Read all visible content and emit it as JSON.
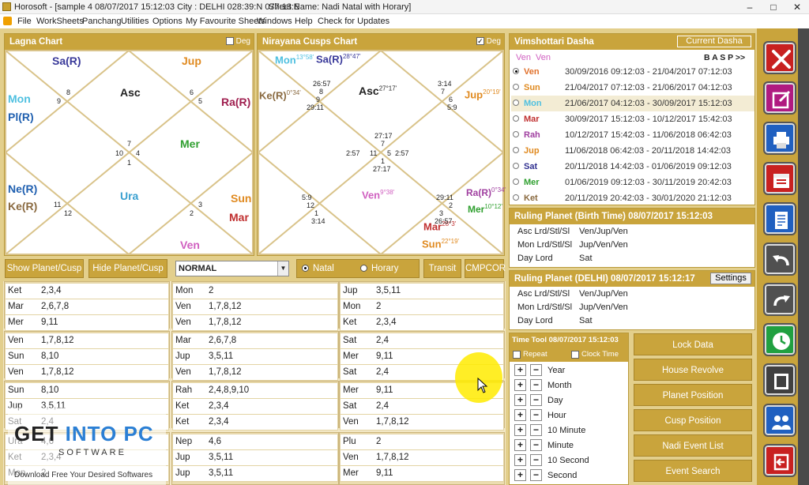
{
  "titlebar": {
    "app": "Horosoft - [sample 4 08/07/2017 15:12:03  City : DELHI 028:39:N 077:13:E",
    "sheet": "Sheet Name: Nadi Natal with Horary]",
    "min": "–",
    "max": "□",
    "close": "✕"
  },
  "menu": [
    "File",
    "WorkSheets",
    "Panchang",
    "Utilities",
    "Options",
    "My Favourite Sheets",
    "Windows",
    "Help",
    "Check for Updates"
  ],
  "lagna": {
    "title": "Lagna Chart",
    "deg": "Deg",
    "planets": {
      "sa": "Sa(R)",
      "jup": "Jup",
      "asc": "Asc",
      "mon": "Mon",
      "pl": "Pl(R)",
      "ra": "Ra(R)",
      "mer": "Mer",
      "ne": "Ne(R)",
      "ke": "Ke(R)",
      "ura": "Ura",
      "sun": "Sun",
      "mar": "Mar",
      "ven": "Ven"
    },
    "nums": {
      "n8": "8",
      "n9": "9",
      "n6": "6",
      "n5": "5",
      "n7": "7",
      "n10": "10",
      "n4": "4",
      "n1": "1",
      "n11": "11",
      "n12": "12",
      "n2": "2",
      "n3": "3"
    }
  },
  "nirayana": {
    "title": "Nirayana Cusps Chart",
    "deg": "Deg",
    "planets": {
      "mon": "Mon",
      "mon_d": "13°58'",
      "sa": "Sa(R)",
      "sa_d": "28°47'",
      "ke": "Ke(R)",
      "ke_d": "0°34'",
      "asc": "Asc",
      "asc_d": "27°17'",
      "jup": "Jup",
      "jup_d": "20°19'",
      "ven": "Ven",
      "ven_d": "9°38'",
      "ra": "Ra(R)",
      "ra_d": "0°34'",
      "mer": "Mer",
      "mer_d": "10°12'",
      "mar": "Mar",
      "mar_d": "28°3'",
      "sun": "Sun",
      "sun_d": "22°19'"
    },
    "nums": {
      "c1": "26:57",
      "c2": "8",
      "c3": "9",
      "c4": "29:11",
      "c5": "3:14",
      "c6": "7",
      "c7": "6",
      "c8": "5:9",
      "c9": "27:17",
      "c10": "7",
      "c11": "2:57",
      "c12": "11",
      "c13": "5",
      "c14": "2:57",
      "c15": "1",
      "c16": "27:17",
      "c17": "5:9",
      "c18": "12",
      "c19": "1",
      "c20": "3:14",
      "c21": "29:11",
      "c22": "2",
      "c23": "3",
      "c24": "26:57"
    }
  },
  "controls": {
    "show": "Show Planet/Cusp",
    "hide": "Hide Planet/Cusp",
    "select": "NORMAL",
    "natal": "Natal",
    "horary": "Horary",
    "transit": "Transit",
    "cmpcor": "CMPCOR"
  },
  "table": {
    "col1": [
      [
        "Ket",
        "2,3,4"
      ],
      [
        "Mar",
        "2,6,7,8"
      ],
      [
        "Mer",
        "9,11"
      ],
      [
        "Ven",
        "1,7,8,12"
      ],
      [
        "Sun",
        "8,10"
      ],
      [
        "Ven",
        "1,7,8,12"
      ],
      [
        "Sun",
        "8,10"
      ],
      [
        "Jup",
        "3,5,11"
      ],
      [
        "Sat",
        "2,4"
      ],
      [
        "Ura",
        "4,6"
      ],
      [
        "Ket",
        "2,3,4"
      ],
      [
        "Mon",
        "2"
      ]
    ],
    "col2": [
      [
        "Mon",
        "2"
      ],
      [
        "Ven",
        "1,7,8,12"
      ],
      [
        "Ven",
        "1,7,8,12"
      ],
      [
        "Mar",
        "2,6,7,8"
      ],
      [
        "Jup",
        "3,5,11"
      ],
      [
        "Ven",
        "1,7,8,12"
      ],
      [
        "Rah",
        "2,4,8,9,10"
      ],
      [
        "Ket",
        "2,3,4"
      ],
      [
        "Ket",
        "2,3,4"
      ],
      [
        "Nep",
        "4,6"
      ],
      [
        "Jup",
        "3,5,11"
      ],
      [
        "Jup",
        "3,5,11"
      ]
    ],
    "col3": [
      [
        "Jup",
        "3,5,11"
      ],
      [
        "Mon",
        "2"
      ],
      [
        "Ket",
        "2,3,4"
      ],
      [
        "Sat",
        "2,4"
      ],
      [
        "Mer",
        "9,11"
      ],
      [
        "Sat",
        "2,4"
      ],
      [
        "Mer",
        "9,11"
      ],
      [
        "Sat",
        "2,4"
      ],
      [
        "Ven",
        "1,7,8,12"
      ],
      [
        "Plu",
        "2"
      ],
      [
        "Ven",
        "1,7,8,12"
      ],
      [
        "Mer",
        "9,11"
      ]
    ]
  },
  "dasha": {
    "title": "Vimshottari Dasha",
    "current": "Current Dasha",
    "h1": "Ven",
    "h2": "Ven",
    "nav": "B A S P >>",
    "rows": [
      {
        "name": "Ven",
        "color": "#e0702a",
        "dates": "30/09/2016 09:12:03 - 21/04/2017 07:12:03"
      },
      {
        "name": "Sun",
        "color": "#e08a20",
        "dates": "21/04/2017 07:12:03 - 21/06/2017 04:12:03"
      },
      {
        "name": "Mon",
        "color": "#4fc0e0",
        "dates": "21/06/2017 04:12:03 - 30/09/2017 15:12:03"
      },
      {
        "name": "Mar",
        "color": "#c03030",
        "dates": "30/09/2017 15:12:03 - 10/12/2017 15:42:03"
      },
      {
        "name": "Rah",
        "color": "#a040a0",
        "dates": "10/12/2017 15:42:03 - 11/06/2018 06:42:03"
      },
      {
        "name": "Jup",
        "color": "#e08a20",
        "dates": "11/06/2018 06:42:03 - 20/11/2018 14:42:03"
      },
      {
        "name": "Sat",
        "color": "#303090",
        "dates": "20/11/2018 14:42:03 - 01/06/2019 09:12:03"
      },
      {
        "name": "Mer",
        "color": "#30a030",
        "dates": "01/06/2019 09:12:03 - 30/11/2019 20:42:03"
      },
      {
        "name": "Ket",
        "color": "#8a6a40",
        "dates": "20/11/2019 20:42:03 - 30/01/2020 21:12:03"
      }
    ]
  },
  "rp_birth": {
    "title": "Ruling Planet (Birth Time) 08/07/2017 15:12:03",
    "rows": [
      [
        "Asc Lrd/Stl/Sl",
        "Ven/Jup/Ven"
      ],
      [
        "Mon Lrd/Stl/Sl",
        "Jup/Ven/Ven"
      ],
      [
        "Day Lord",
        "Sat"
      ]
    ]
  },
  "rp_delhi": {
    "title": "Ruling Planet (DELHI) 08/07/2017 15:12:17",
    "settings": "Settings",
    "rows": [
      [
        "Asc Lrd/Stl/Sl",
        "Ven/Jup/Ven"
      ],
      [
        "Mon Lrd/Stl/Sl",
        "Jup/Ven/Ven"
      ],
      [
        "Day Lord",
        "Sat"
      ]
    ]
  },
  "timetool": {
    "title": "Time Tool 08/07/2017 15:12:03",
    "repeat": "Repeat",
    "clock": "Clock Time",
    "plus": "+",
    "minus": "−",
    "units": [
      "Year",
      "Month",
      "Day",
      "Hour",
      "10 Minute",
      "Minute",
      "10 Second",
      "Second"
    ]
  },
  "side_buttons": [
    "Lock Data",
    "House Revolve",
    "Planet Position",
    "Cusp Position",
    "Nadi Event List",
    "Event Search"
  ],
  "toolbar_icons": [
    "tools-icon",
    "edit-icon",
    "print-icon",
    "calendar-icon",
    "document-icon",
    "undo-icon",
    "redo-icon",
    "clock-icon",
    "book-icon",
    "people-icon",
    "exit-icon"
  ],
  "watermark": {
    "brand1": "GET ",
    "brand2": "INTO PC",
    "sub": "SOFTWARE",
    "tag": "Download Free Your Desired Softwares"
  },
  "colors": {
    "gold": "#c9a43c",
    "sa": "#3a3a9a",
    "jup": "#e08a20",
    "mon": "#4fc0e0",
    "ra": "#a02050",
    "mer": "#30a030",
    "ke": "#8a6a40",
    "ura": "#3aa0d0",
    "sun": "#e08a20",
    "mar": "#c03030",
    "ven": "#d060c0",
    "ne": "#2060b0"
  }
}
